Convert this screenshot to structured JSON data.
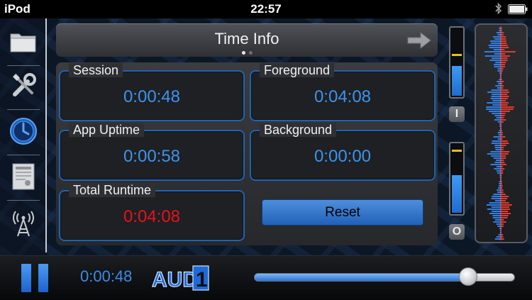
{
  "status_bar": {
    "carrier": "iPod",
    "time": "22:57"
  },
  "header": {
    "title": "Time Info",
    "page_count": 2,
    "active_page": 1
  },
  "stats": {
    "session": {
      "label": "Session",
      "value": "0:00:48"
    },
    "foreground": {
      "label": "Foreground",
      "value": "0:04:08"
    },
    "app_uptime": {
      "label": "App Uptime",
      "value": "0:00:58"
    },
    "background": {
      "label": "Background",
      "value": "0:00:00"
    },
    "total_runtime": {
      "label": "Total Runtime",
      "value": "0:04:08"
    }
  },
  "reset_label": "Reset",
  "meters": {
    "input": {
      "button_label": "I",
      "level": 0.45,
      "peak": 0.6
    },
    "output": {
      "button_label": "O",
      "level": 0.55,
      "peak": 0.9
    }
  },
  "bottom": {
    "elapsed": "0:00:48",
    "logo_text": "AUD",
    "logo_digit": "1",
    "playback_position": 0.82
  },
  "colors": {
    "accent_blue": "#3d93ee",
    "alert_red": "#e8121a",
    "border_blue": "#1f63b5"
  },
  "icons": [
    "folder-icon",
    "tools-icon",
    "clock-icon",
    "certificate-icon",
    "antenna-icon",
    "bluetooth-icon",
    "battery-icon",
    "arrow-right-icon",
    "pause-icon"
  ]
}
